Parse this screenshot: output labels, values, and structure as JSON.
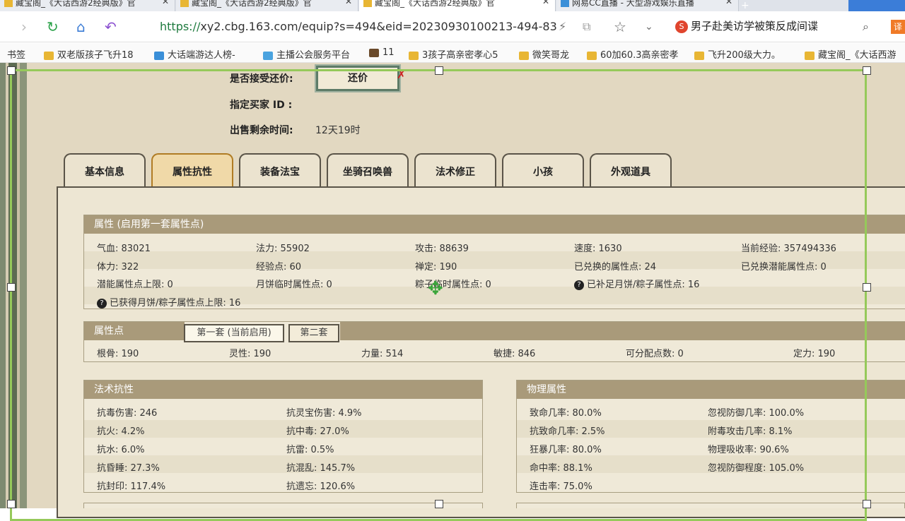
{
  "browser": {
    "tabs": [
      {
        "label": "藏宝阁_《大话西游2经典版》官",
        "active": false
      },
      {
        "label": "藏宝阁_《大话西游2经典版》官",
        "active": false
      },
      {
        "label": "藏宝阁_《大话西游2经典版》官",
        "active": true
      },
      {
        "label": "网易CC直播 - 大型游戏娱乐直播",
        "active": false
      }
    ],
    "url_scheme": "https://",
    "url_rest": "xy2.cbg.163.com/equip?s=494&eid=20230930100213-494-83",
    "search_engine": "S",
    "search_text": "男子赴美访学被策反成间谍",
    "translate_label": "译",
    "bookmarks_label": "书签",
    "bookmarks": [
      "双老版孩子飞升18",
      "大话端游达人榜-",
      "主播公会服务平台",
      "11",
      "3孩子高亲密孝心5",
      "微笑哥龙",
      "60加60.3高亲密孝",
      "飞升200级大力。",
      "藏宝阁_《大话西游"
    ]
  },
  "trade": {
    "accept_offer_label": "是否接受还价:",
    "offer_button": "还价",
    "buyer_id_label": "指定买家 ID :",
    "time_left_label": "出售剩余时间:",
    "time_left_value": "12天19时"
  },
  "game_tabs": [
    "基本信息",
    "属性抗性",
    "装备法宝",
    "坐骑召唤兽",
    "法术修正",
    "小孩",
    "外观道具"
  ],
  "selected_tab": "属性抗性",
  "attributes": {
    "header": "属性 (启用第一套属性点)",
    "rows": [
      [
        "气血: 83021",
        "法力: 55902",
        "攻击: 88639",
        "速度: 1630",
        "当前经验: 357494336"
      ],
      [
        "体力: 322",
        "经验点: 60",
        "禅定: 190",
        "已兑换的属性点: 24",
        "已兑换潜能属性点: 0"
      ],
      [
        "潜能属性点上限: 0",
        "月饼临时属性点: 0",
        "粽子临时属性点: 0",
        "已补足月饼/粽子属性点: 16",
        ""
      ],
      [
        "已获得月饼/粽子属性点上限: 16",
        "",
        "",
        "",
        ""
      ]
    ]
  },
  "points": {
    "header": "属性点",
    "tab1": "第一套 (当前启用)",
    "tab2": "第二套",
    "values": [
      "根骨: 190",
      "灵性: 190",
      "力量: 514",
      "敏捷: 846",
      "可分配点数: 0",
      "定力: 190"
    ]
  },
  "magic_resist": {
    "header": "法术抗性",
    "rows": [
      [
        "抗毒伤害: 246",
        "抗灵宝伤害: 4.9%"
      ],
      [
        "抗火: 4.2%",
        "抗中毒: 27.0%"
      ],
      [
        "抗水: 6.0%",
        "抗雷: 0.5%"
      ],
      [
        "抗昏睡: 27.3%",
        "抗混乱: 145.7%"
      ],
      [
        "抗封印: 117.4%",
        "抗遗忘: 120.6%"
      ]
    ]
  },
  "physical": {
    "header": "物理属性",
    "rows": [
      [
        "致命几率: 80.0%",
        "忽视防御几率: 100.0%"
      ],
      [
        "抗致命几率: 2.5%",
        "附毒攻击几率: 8.1%"
      ],
      [
        "狂暴几率: 80.0%",
        "物理吸收率: 90.6%"
      ],
      [
        "命中率: 88.1%",
        "忽视防御程度: 105.0%"
      ],
      [
        "连击率: 75.0%",
        ""
      ]
    ]
  },
  "colors": {
    "header_bg": "#a99a7a",
    "selected_tab": "#f0d9a8",
    "url_green": "#1e7a3e",
    "selection_green": "#95c95a"
  }
}
